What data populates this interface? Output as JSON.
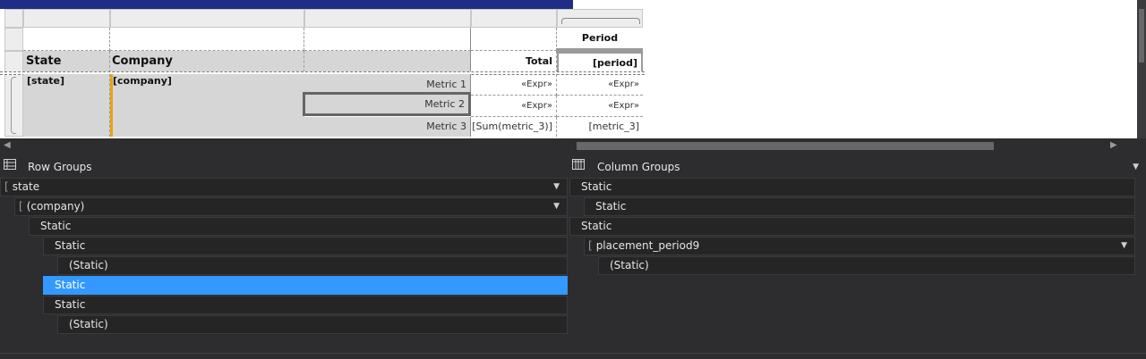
{
  "report": {
    "column_group_header": "Period",
    "headers": {
      "state": "State",
      "company": "Company",
      "total": "Total",
      "period": "[period]"
    },
    "row": {
      "state": "[state]",
      "company": "[company]"
    },
    "metrics": [
      {
        "label": "Metric 1",
        "total": "«Expr»",
        "period": "«Expr»"
      },
      {
        "label": "Metric 2",
        "total": "«Expr»",
        "period": "«Expr»"
      },
      {
        "label": "Metric 3",
        "total": "[Sum(metric_3)]",
        "period": "[metric_3]"
      }
    ]
  },
  "row_groups": {
    "title": "Row Groups",
    "items": [
      {
        "label": "state"
      },
      {
        "label": "(company)"
      },
      {
        "label": "Static"
      },
      {
        "label": "Static"
      },
      {
        "label": "(Static)"
      },
      {
        "label": "Static"
      },
      {
        "label": "Static"
      },
      {
        "label": "(Static)"
      }
    ]
  },
  "column_groups": {
    "title": "Column Groups",
    "items": [
      {
        "label": "Static"
      },
      {
        "label": "Static"
      },
      {
        "label": "Static"
      },
      {
        "label": "placement_period9"
      },
      {
        "label": "(Static)"
      }
    ]
  },
  "colors": {
    "selection": "#3399ff",
    "pane_background": "#252526",
    "title_bar": "#1f2d86",
    "group_indicator": "#e8a317"
  }
}
